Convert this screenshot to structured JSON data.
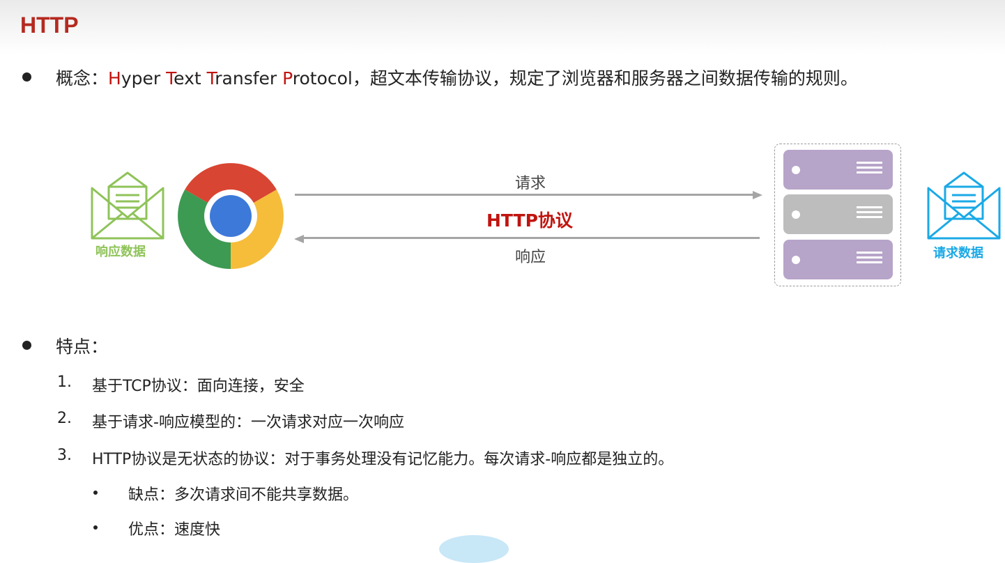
{
  "title": "HTTP",
  "concept": {
    "prefix": "概念：",
    "protocol_words": [
      {
        "initial": "H",
        "rest": "yper "
      },
      {
        "initial": "T",
        "rest": "ext "
      },
      {
        "initial": "T",
        "rest": "ransfer "
      },
      {
        "initial": "P",
        "rest": "rotocol"
      }
    ],
    "suffix": "，超文本传输协议，规定了浏览器和服务器之间数据传输的规则。"
  },
  "diagram": {
    "response_data_label": "响应数据",
    "request_data_label": "请求数据",
    "request_arrow_label": "请求",
    "response_arrow_label": "响应",
    "protocol_label": "HTTP协议",
    "colors": {
      "green": "#8fc359",
      "blue": "#1aa9e6",
      "server_purple": "#b7a4c9",
      "server_gray": "#bdbdbd",
      "arrow": "#a5a5a5",
      "accent_red": "#c0140f"
    },
    "icons": [
      "envelope-green-icon",
      "chrome-browser-icon",
      "server-icon",
      "envelope-blue-icon"
    ]
  },
  "features": {
    "heading": "特点：",
    "items": [
      {
        "num": "1.",
        "text": "基于TCP协议：面向连接，安全"
      },
      {
        "num": "2.",
        "text": "基于请求-响应模型的：一次请求对应一次响应"
      },
      {
        "num": "3.",
        "text": "HTTP协议是无状态的协议：对于事务处理没有记忆能力。每次请求-响应都是独立的。"
      }
    ],
    "sub_items": [
      {
        "text": "缺点：多次请求间不能共享数据。"
      },
      {
        "text": "优点：速度快"
      }
    ]
  }
}
